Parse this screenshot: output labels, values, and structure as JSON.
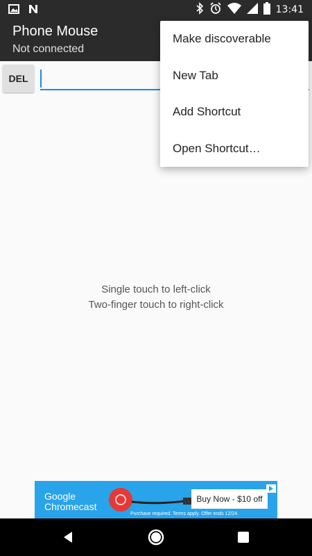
{
  "status_bar": {
    "time": "13:41",
    "icons": [
      "image-icon",
      "n-icon",
      "bluetooth-icon",
      "alarm-icon",
      "wifi-icon",
      "signal-icon",
      "battery-icon"
    ]
  },
  "app_bar": {
    "title": "Phone Mouse",
    "subtitle": "Not connected"
  },
  "toolbar": {
    "del_label": "DEL",
    "text_value": ""
  },
  "touch_area": {
    "hint_line1": "Single touch to left-click",
    "hint_line2": "Two-finger touch to right-click"
  },
  "menu": {
    "items": [
      "Make discoverable",
      "New Tab",
      "Add Shortcut",
      "Open Shortcut…"
    ]
  },
  "ad": {
    "brand_line1": "Google",
    "brand_line2": "Chromecast",
    "cta": "Buy Now - $10 off",
    "fine_print": "Purchase required. Terms apply. Offer ends 12/24."
  },
  "nav_bar": {
    "buttons": [
      "back-icon",
      "home-icon",
      "recents-icon"
    ]
  },
  "colors": {
    "app_bar": "#2b2b2b",
    "accent": "#1e88e5",
    "ad_bg": "#29a3ea"
  }
}
